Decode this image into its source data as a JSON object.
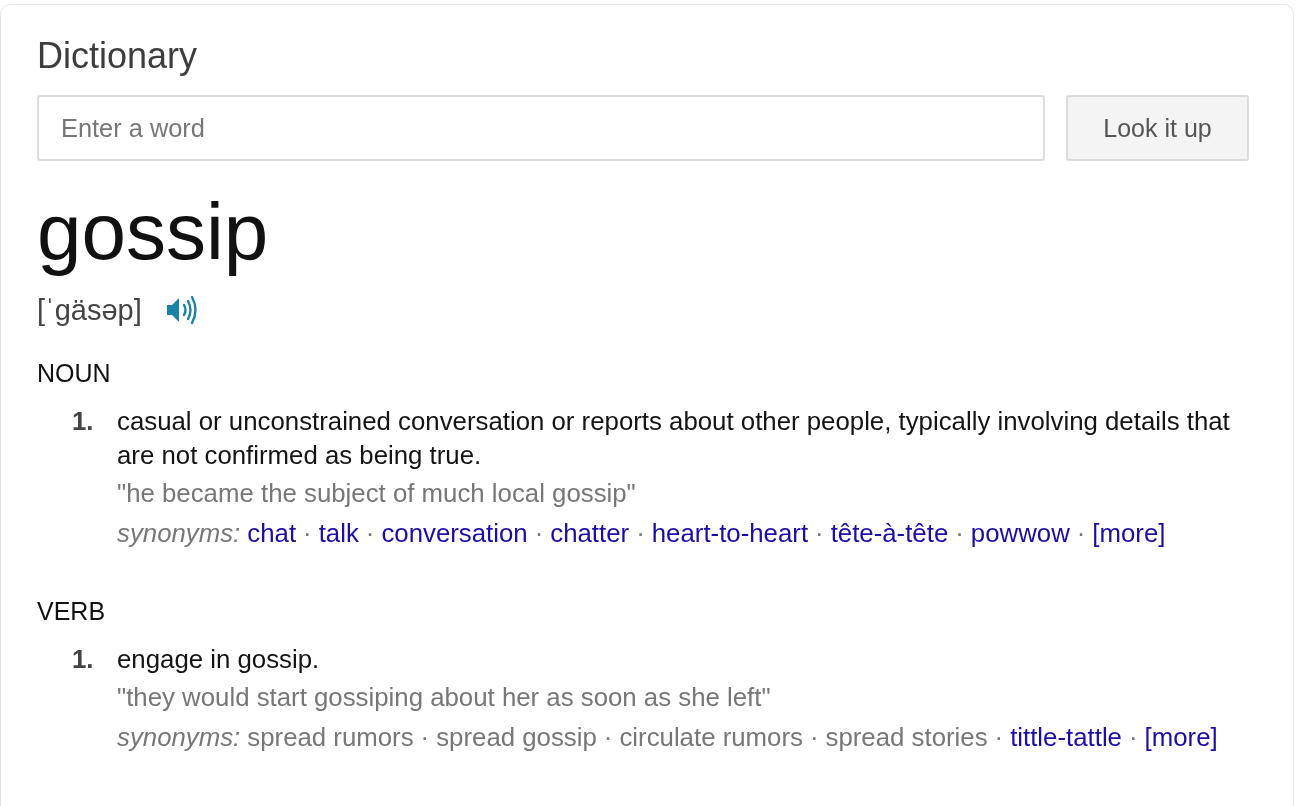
{
  "panel": {
    "title": "Dictionary"
  },
  "search": {
    "placeholder": "Enter a word",
    "button": "Look it up"
  },
  "entry": {
    "word": "gossip",
    "pronunciation": "[ˈgäsəp]"
  },
  "senses": [
    {
      "part_of_speech": "NOUN",
      "definitions": [
        {
          "number": "1.",
          "text": "casual or unconstrained conversation or reports about other people, typically involving details that are not confirmed as being true.",
          "example": "\"he became the subject of much local gossip\"",
          "synonyms": {
            "label": "synonyms:",
            "items": [
              {
                "text": "chat",
                "linked": true,
                "separator": "·"
              },
              {
                "text": "talk",
                "linked": true,
                "separator": "·"
              },
              {
                "text": "conversation",
                "linked": true,
                "separator": "·"
              },
              {
                "text": "chatter",
                "linked": true,
                "separator": "·"
              },
              {
                "text": "heart-to-heart",
                "linked": true,
                "separator": "·"
              },
              {
                "text": "tête-à-tête",
                "linked": true,
                "separator": "·"
              },
              {
                "text": "powwow",
                "linked": true,
                "separator": "·"
              },
              {
                "text": "[more]",
                "linked": true
              }
            ]
          }
        }
      ]
    },
    {
      "part_of_speech": "VERB",
      "definitions": [
        {
          "number": "1.",
          "text": "engage in gossip.",
          "example": "\"they would start gossiping about her as soon as she left\"",
          "synonyms": {
            "label": "synonyms:",
            "items": [
              {
                "text": "spread rumors",
                "linked": false,
                "separator": "·"
              },
              {
                "text": "spread gossip",
                "linked": false,
                "separator": "·"
              },
              {
                "text": "circulate rumors",
                "linked": false,
                "separator": "·"
              },
              {
                "text": "spread stories",
                "linked": false,
                "separator": "·"
              },
              {
                "text": "tittle-tattle",
                "linked": true,
                "separator": "·"
              },
              {
                "text": "[more]",
                "linked": true
              }
            ]
          }
        }
      ]
    }
  ]
}
